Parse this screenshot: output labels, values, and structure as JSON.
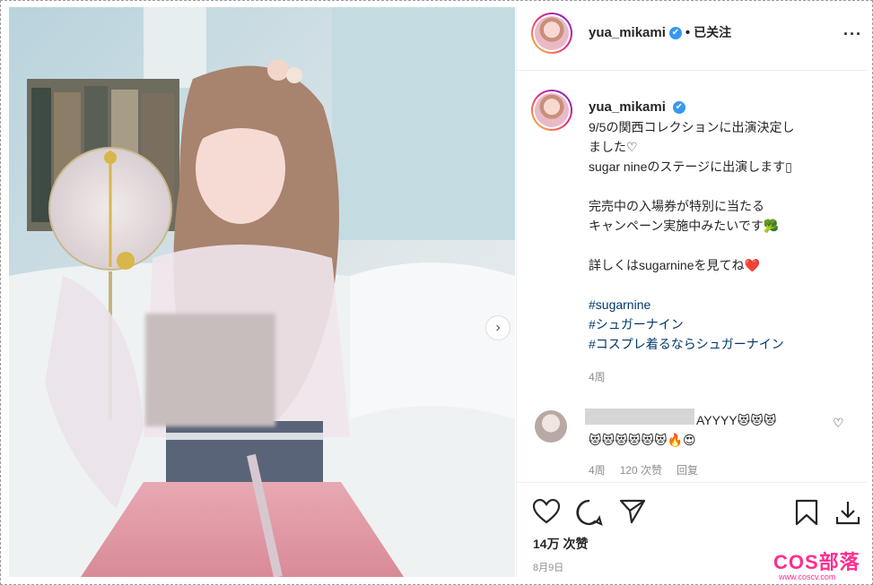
{
  "header": {
    "username": "yua_mikami",
    "verified_mark": "✔",
    "separator": "•",
    "follow_status": "已关注",
    "more_label": "···"
  },
  "caption": {
    "username": "yua_mikami",
    "lines": [
      "9/5の関西コレクションに出演決定し",
      "ました♡",
      "sugar nineのステージに出演します▯",
      "",
      "完売中の入場券が特別に当たる",
      "キャンペーン実施中みたいです🥦",
      "",
      "詳しくはsugarnineを見てね❤️",
      ""
    ],
    "hashtags": [
      "#sugarnine",
      "#シュガーナイン",
      "#コスプレ着るならシュガーナイン"
    ],
    "time": "4周"
  },
  "comment": {
    "text_line1": "AYYYY😻😻😻",
    "text_line2": "😻😻😻😻😻😻🔥😍",
    "time": "4周",
    "likes": "120 次赞",
    "reply": "回复"
  },
  "actions": {
    "likes": "14万 次赞",
    "date": "8月9日"
  },
  "photo": {
    "next_arrow": "›"
  },
  "watermark": {
    "title": "COS部落",
    "url": "www.coscv.com"
  },
  "colors": {
    "link": "#00376b",
    "verified": "#3897f0",
    "watermark": "#ff2d8e"
  }
}
